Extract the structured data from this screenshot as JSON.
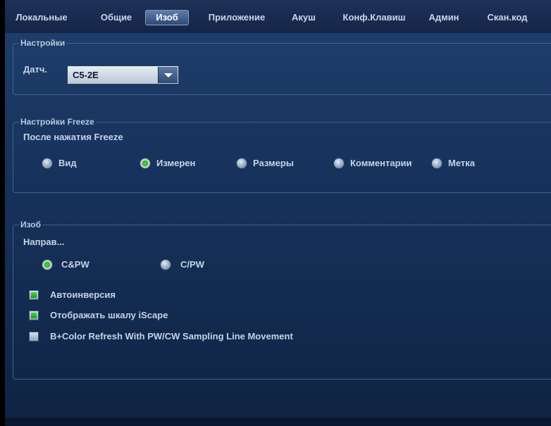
{
  "tabs": [
    {
      "label": "Локальные",
      "active": false
    },
    {
      "label": "Общие",
      "active": false
    },
    {
      "label": "Изоб",
      "active": true
    },
    {
      "label": "Приложение",
      "active": false
    },
    {
      "label": "Акуш",
      "active": false
    },
    {
      "label": "Конф.Клавиш",
      "active": false
    },
    {
      "label": "Админ",
      "active": false
    },
    {
      "label": "Скан.код",
      "active": false
    }
  ],
  "settings": {
    "legend": "Настройки",
    "probe_label": "Датч.",
    "probe_value": "C5-2E"
  },
  "freeze": {
    "legend": "Настройки Freeze",
    "subtitle": "После нажатия Freeze",
    "options": [
      {
        "label": "Вид",
        "selected": false
      },
      {
        "label": "Измерен",
        "selected": true
      },
      {
        "label": "Размеры",
        "selected": false
      },
      {
        "label": "Комментарии",
        "selected": false
      },
      {
        "label": "Метка",
        "selected": false
      }
    ]
  },
  "image": {
    "legend": "Изоб",
    "direction_label": "Направ...",
    "direction_options": [
      {
        "label": "C&PW",
        "selected": true
      },
      {
        "label": "C/PW",
        "selected": false
      }
    ],
    "checkboxes": [
      {
        "label": "Автоинверсия",
        "checked": true
      },
      {
        "label": "Отображать шкалу iScape",
        "checked": true
      },
      {
        "label": "B+Color Refresh With PW/CW Sampling Line Movement",
        "checked": false
      }
    ]
  },
  "colors": {
    "background": "#0f1d39",
    "accent_green": "#22b02a",
    "text": "#c5d3e6"
  }
}
